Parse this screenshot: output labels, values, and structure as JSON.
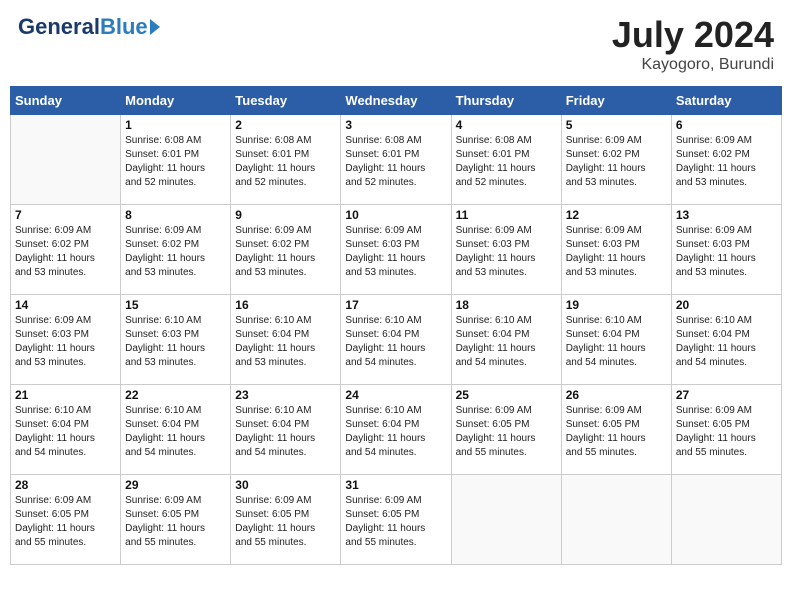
{
  "header": {
    "logo_general": "General",
    "logo_blue": "Blue",
    "month_year": "July 2024",
    "location": "Kayogoro, Burundi"
  },
  "days_of_week": [
    "Sunday",
    "Monday",
    "Tuesday",
    "Wednesday",
    "Thursday",
    "Friday",
    "Saturday"
  ],
  "weeks": [
    [
      {
        "day": "",
        "info": ""
      },
      {
        "day": "1",
        "info": "Sunrise: 6:08 AM\nSunset: 6:01 PM\nDaylight: 11 hours\nand 52 minutes."
      },
      {
        "day": "2",
        "info": "Sunrise: 6:08 AM\nSunset: 6:01 PM\nDaylight: 11 hours\nand 52 minutes."
      },
      {
        "day": "3",
        "info": "Sunrise: 6:08 AM\nSunset: 6:01 PM\nDaylight: 11 hours\nand 52 minutes."
      },
      {
        "day": "4",
        "info": "Sunrise: 6:08 AM\nSunset: 6:01 PM\nDaylight: 11 hours\nand 52 minutes."
      },
      {
        "day": "5",
        "info": "Sunrise: 6:09 AM\nSunset: 6:02 PM\nDaylight: 11 hours\nand 53 minutes."
      },
      {
        "day": "6",
        "info": "Sunrise: 6:09 AM\nSunset: 6:02 PM\nDaylight: 11 hours\nand 53 minutes."
      }
    ],
    [
      {
        "day": "7",
        "info": "Sunrise: 6:09 AM\nSunset: 6:02 PM\nDaylight: 11 hours\nand 53 minutes."
      },
      {
        "day": "8",
        "info": "Sunrise: 6:09 AM\nSunset: 6:02 PM\nDaylight: 11 hours\nand 53 minutes."
      },
      {
        "day": "9",
        "info": "Sunrise: 6:09 AM\nSunset: 6:02 PM\nDaylight: 11 hours\nand 53 minutes."
      },
      {
        "day": "10",
        "info": "Sunrise: 6:09 AM\nSunset: 6:03 PM\nDaylight: 11 hours\nand 53 minutes."
      },
      {
        "day": "11",
        "info": "Sunrise: 6:09 AM\nSunset: 6:03 PM\nDaylight: 11 hours\nand 53 minutes."
      },
      {
        "day": "12",
        "info": "Sunrise: 6:09 AM\nSunset: 6:03 PM\nDaylight: 11 hours\nand 53 minutes."
      },
      {
        "day": "13",
        "info": "Sunrise: 6:09 AM\nSunset: 6:03 PM\nDaylight: 11 hours\nand 53 minutes."
      }
    ],
    [
      {
        "day": "14",
        "info": "Sunrise: 6:09 AM\nSunset: 6:03 PM\nDaylight: 11 hours\nand 53 minutes."
      },
      {
        "day": "15",
        "info": "Sunrise: 6:10 AM\nSunset: 6:03 PM\nDaylight: 11 hours\nand 53 minutes."
      },
      {
        "day": "16",
        "info": "Sunrise: 6:10 AM\nSunset: 6:04 PM\nDaylight: 11 hours\nand 53 minutes."
      },
      {
        "day": "17",
        "info": "Sunrise: 6:10 AM\nSunset: 6:04 PM\nDaylight: 11 hours\nand 54 minutes."
      },
      {
        "day": "18",
        "info": "Sunrise: 6:10 AM\nSunset: 6:04 PM\nDaylight: 11 hours\nand 54 minutes."
      },
      {
        "day": "19",
        "info": "Sunrise: 6:10 AM\nSunset: 6:04 PM\nDaylight: 11 hours\nand 54 minutes."
      },
      {
        "day": "20",
        "info": "Sunrise: 6:10 AM\nSunset: 6:04 PM\nDaylight: 11 hours\nand 54 minutes."
      }
    ],
    [
      {
        "day": "21",
        "info": "Sunrise: 6:10 AM\nSunset: 6:04 PM\nDaylight: 11 hours\nand 54 minutes."
      },
      {
        "day": "22",
        "info": "Sunrise: 6:10 AM\nSunset: 6:04 PM\nDaylight: 11 hours\nand 54 minutes."
      },
      {
        "day": "23",
        "info": "Sunrise: 6:10 AM\nSunset: 6:04 PM\nDaylight: 11 hours\nand 54 minutes."
      },
      {
        "day": "24",
        "info": "Sunrise: 6:10 AM\nSunset: 6:04 PM\nDaylight: 11 hours\nand 54 minutes."
      },
      {
        "day": "25",
        "info": "Sunrise: 6:09 AM\nSunset: 6:05 PM\nDaylight: 11 hours\nand 55 minutes."
      },
      {
        "day": "26",
        "info": "Sunrise: 6:09 AM\nSunset: 6:05 PM\nDaylight: 11 hours\nand 55 minutes."
      },
      {
        "day": "27",
        "info": "Sunrise: 6:09 AM\nSunset: 6:05 PM\nDaylight: 11 hours\nand 55 minutes."
      }
    ],
    [
      {
        "day": "28",
        "info": "Sunrise: 6:09 AM\nSunset: 6:05 PM\nDaylight: 11 hours\nand 55 minutes."
      },
      {
        "day": "29",
        "info": "Sunrise: 6:09 AM\nSunset: 6:05 PM\nDaylight: 11 hours\nand 55 minutes."
      },
      {
        "day": "30",
        "info": "Sunrise: 6:09 AM\nSunset: 6:05 PM\nDaylight: 11 hours\nand 55 minutes."
      },
      {
        "day": "31",
        "info": "Sunrise: 6:09 AM\nSunset: 6:05 PM\nDaylight: 11 hours\nand 55 minutes."
      },
      {
        "day": "",
        "info": ""
      },
      {
        "day": "",
        "info": ""
      },
      {
        "day": "",
        "info": ""
      }
    ]
  ]
}
